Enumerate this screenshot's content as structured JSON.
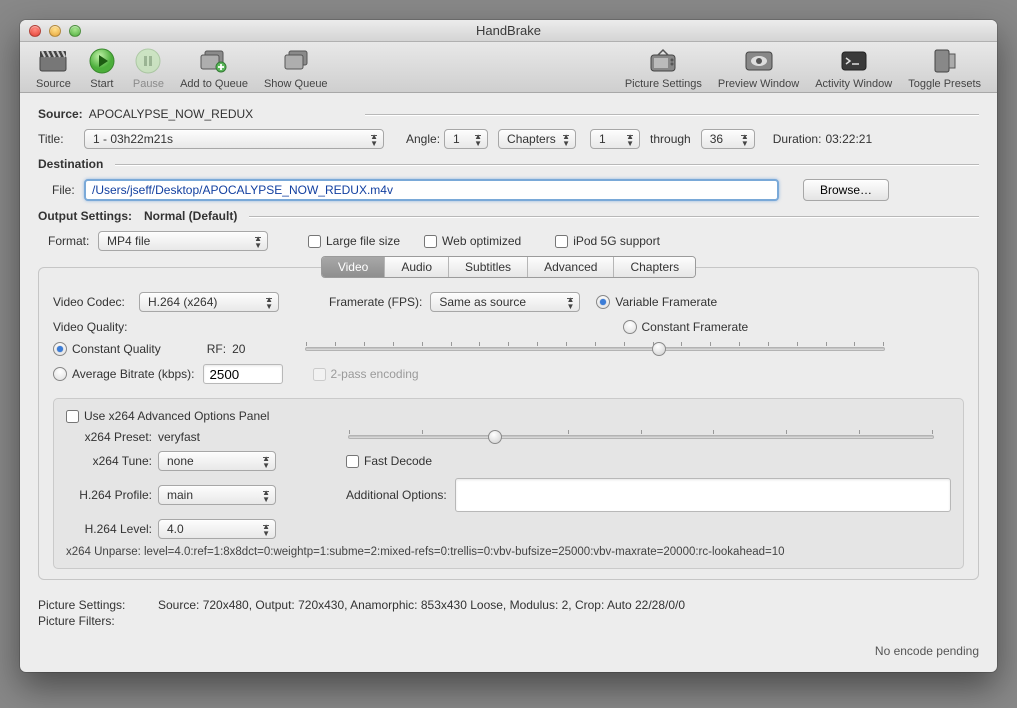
{
  "window": {
    "title": "HandBrake"
  },
  "toolbar": {
    "source": "Source",
    "start": "Start",
    "pause": "Pause",
    "add_queue": "Add to Queue",
    "show_queue": "Show Queue",
    "picture_settings": "Picture Settings",
    "preview_window": "Preview Window",
    "activity_window": "Activity Window",
    "toggle_presets": "Toggle Presets"
  },
  "source": {
    "label": "Source:",
    "value": "APOCALYPSE_NOW_REDUX"
  },
  "title": {
    "label": "Title:",
    "value": "1 - 03h22m21s"
  },
  "angle": {
    "label": "Angle:",
    "value": "1"
  },
  "chapters_type": {
    "value": "Chapters"
  },
  "chapter_from": "1",
  "through": "through",
  "chapter_to": "36",
  "duration": {
    "label": "Duration:",
    "value": "03:22:21"
  },
  "dest_label": "Destination",
  "file_label": "File:",
  "file_value": "/Users/jseff/Desktop/APOCALYPSE_NOW_REDUX.m4v",
  "browse": "Browse…",
  "output_label": "Output Settings:",
  "output_value": "Normal (Default)",
  "format_label": "Format:",
  "format_value": "MP4 file",
  "large_file": "Large file size",
  "web_optimized": "Web optimized",
  "ipod": "iPod 5G support",
  "tabs": {
    "video": "Video",
    "audio": "Audio",
    "subtitles": "Subtitles",
    "advanced": "Advanced",
    "chapters": "Chapters"
  },
  "video_codec_label": "Video Codec:",
  "video_codec": "H.264 (x264)",
  "framerate_label": "Framerate (FPS):",
  "framerate": "Same as source",
  "variable_fr": "Variable Framerate",
  "constant_fr": "Constant Framerate",
  "video_quality_label": "Video Quality:",
  "constant_quality": "Constant Quality",
  "rf_label": "RF:",
  "rf_value": "20",
  "avg_bitrate": "Average Bitrate (kbps):",
  "bitrate_value": "2500",
  "two_pass": "2-pass encoding",
  "use_adv": "Use x264 Advanced Options Panel",
  "preset_label": "x264 Preset:",
  "preset_value": "veryfast",
  "tune_label": "x264 Tune:",
  "tune_value": "none",
  "fast_decode": "Fast Decode",
  "profile_label": "H.264 Profile:",
  "profile_value": "main",
  "additional_label": "Additional Options:",
  "level_label": "H.264 Level:",
  "level_value": "4.0",
  "unparse": "x264 Unparse: level=4.0:ref=1:8x8dct=0:weightp=1:subme=2:mixed-refs=0:trellis=0:vbv-bufsize=25000:vbv-maxrate=20000:rc-lookahead=10",
  "pic_settings_label": "Picture Settings:",
  "pic_settings_value": "Source: 720x480, Output: 720x430, Anamorphic: 853x430 Loose, Modulus: 2, Crop: Auto 22/28/0/0",
  "pic_filters_label": "Picture Filters:",
  "status": "No encode pending"
}
